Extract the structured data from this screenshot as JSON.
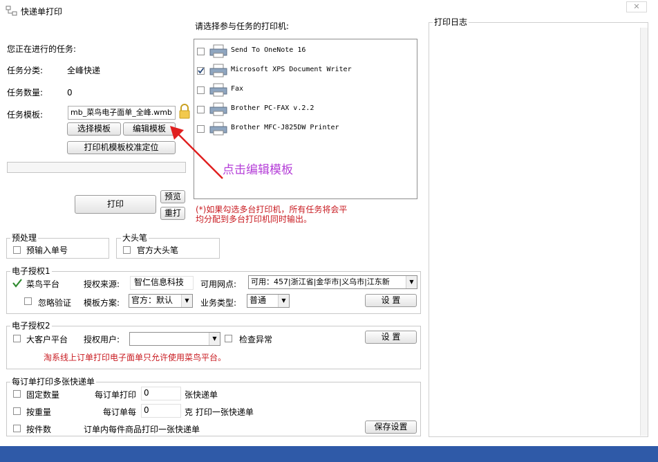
{
  "window": {
    "title": "快递单打印"
  },
  "task": {
    "current_label": "您正在进行的任务:",
    "category_label": "任务分类:",
    "category_value": "全峰快递",
    "count_label": "任务数量:",
    "count_value": "0",
    "template_label": "任务模板:",
    "template_value": "mb_菜鸟电子面单_全峰.wmb"
  },
  "buttons": {
    "select_template": "选择模板",
    "edit_template": "编辑模板",
    "calibrate": "打印机模板校准定位",
    "print": "打印",
    "preview": "预览",
    "reprint": "重打"
  },
  "printers": {
    "heading": "请选择参与任务的打印机:",
    "items": [
      {
        "name": "Send To OneNote 16",
        "checked": false
      },
      {
        "name": "Microsoft XPS Document Writer",
        "checked": true
      },
      {
        "name": "Fax",
        "checked": false
      },
      {
        "name": "Brother PC-FAX v.2.2",
        "checked": false
      },
      {
        "name": "Brother MFC-J825DW Printer",
        "checked": false
      }
    ],
    "note_line1": "(*)如果勾选多台打印机，所有任务将会平",
    "note_line2": "均分配到多台打印机同时输出。"
  },
  "annotation": {
    "text": "点击编辑模板"
  },
  "preprocess": {
    "title": "预处理",
    "option": "预输入单号"
  },
  "big_pen": {
    "title": "大头笔",
    "option": "官方大头笔"
  },
  "auth1": {
    "title": "电子授权1",
    "platform": "菜鸟平台",
    "source_label": "授权来源:",
    "source_value": "智仁信息科技",
    "outlet_label": "可用网点:",
    "outlet_value": "可用：457|浙江省|金华市|义乌市|江东新",
    "ignore_verify": "忽略验证",
    "scheme_label": "模板方案:",
    "scheme_value": "官方：默认",
    "biz_label": "业务类型:",
    "biz_value": "普通",
    "settings": "设 置"
  },
  "auth2": {
    "title": "电子授权2",
    "platform": "大客户平台",
    "user_label": "授权用户:",
    "user_value": "",
    "check_abnormal": "检查异常",
    "settings": "设 置",
    "warning": "淘系线上订单打印电子面单只允许使用菜鸟平台。"
  },
  "multi": {
    "title": "每订单打印多张快递单",
    "fixed_label": "固定数量",
    "per_order_label": "每订单打印",
    "per_order_value": "0",
    "per_order_unit": "张快递单",
    "by_weight_label": "按重量",
    "weight_label": "每订单每",
    "weight_value": "0",
    "weight_unit": "克 打印一张快递单",
    "by_item_label": "按件数",
    "by_item_desc": "订单内每件商品打印一张快递单",
    "save": "保存设置"
  },
  "log": {
    "title": "打印日志"
  },
  "colors": {
    "accent_red": "#c8191f",
    "annotation_purple": "#b53fd8",
    "taskbar": "#2f5aa8"
  }
}
